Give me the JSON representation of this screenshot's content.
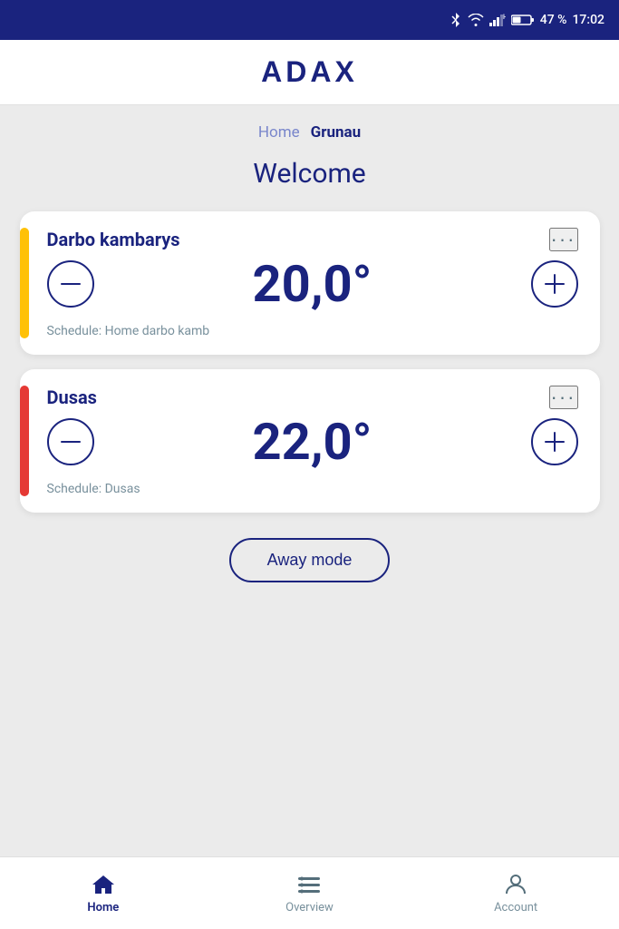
{
  "statusBar": {
    "battery": "47 %",
    "time": "17:02"
  },
  "header": {
    "logo": "ADAX"
  },
  "breadcrumb": {
    "home": "Home",
    "current": "Grunau"
  },
  "welcome": "Welcome",
  "cards": [
    {
      "id": "darbo",
      "name": "Darbo kambarys",
      "temperature": "20,0°",
      "schedule": "Schedule: Home darbo kamb",
      "accentClass": "accent-yellow"
    },
    {
      "id": "dusas",
      "name": "Dusas",
      "temperature": "22,0°",
      "schedule": "Schedule: Dusas",
      "accentClass": "accent-orange"
    }
  ],
  "awayModeBtn": "Away mode",
  "bottomNav": {
    "home": "Home",
    "overview": "Overview",
    "account": "Account"
  }
}
